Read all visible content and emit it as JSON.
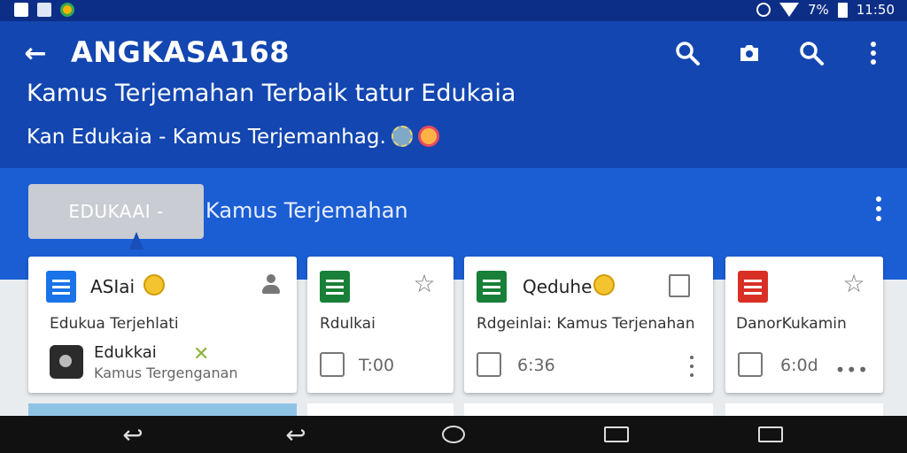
{
  "status_bar": {
    "battery_percent": "7%",
    "time": "11:50",
    "icons": [
      "notification-r-icon",
      "notification-n-icon",
      "notification-app-icon",
      "alarm-icon",
      "wifi-icon",
      "battery-icon"
    ]
  },
  "app_bar": {
    "title": "ANGKASA168",
    "subtitle": "Kamus Terjemahan Terbaik tatur Edukaia",
    "secondary": "Kan Edukaia - Kamus Terjemanhag.",
    "actions": [
      "search-icon",
      "camera-icon",
      "search-icon",
      "more-vert-icon"
    ]
  },
  "tab_bar": {
    "chip_label": "EDUKAAI -",
    "label": "Kamus Terjemahan"
  },
  "cards": [
    {
      "title": "ASIai",
      "text": "Edukua Terjehlati",
      "owner": "Edukkai",
      "owner_sub": "Kamus Tergenganan",
      "icon": "docs-icon",
      "icon_color": "#1a73e8"
    },
    {
      "title": "",
      "text": "Rdulkai",
      "time": "T:00",
      "icon": "sheets-icon",
      "icon_color": "#188038"
    },
    {
      "title": "Qeduhe",
      "text": "Rdgeinlai: Kamus Terjenahan",
      "time": "6:36",
      "icon": "slides-icon",
      "icon_color": "#188038"
    },
    {
      "title": "",
      "text": "DanorKukamin",
      "time": "6:0d",
      "icon": "forms-icon",
      "icon_color": "#d93025"
    }
  ],
  "colors": {
    "app_bar": "#1346b0",
    "tab_bar": "#1b5ed4",
    "status_bar": "#0d2e86"
  }
}
